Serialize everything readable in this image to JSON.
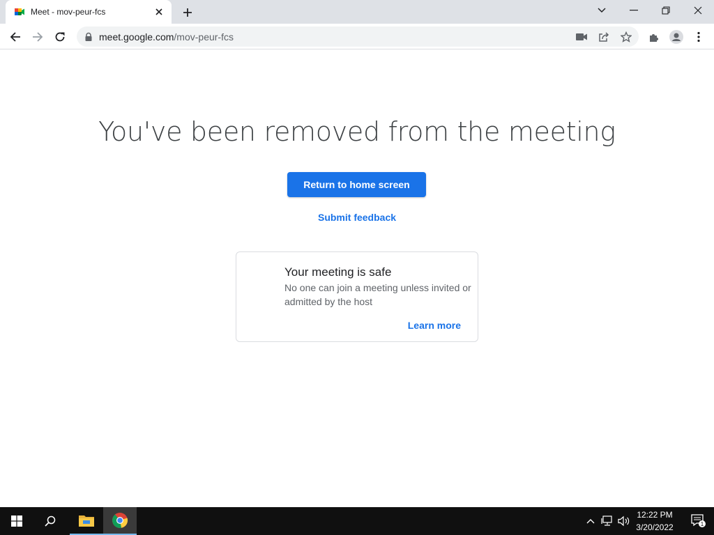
{
  "browser": {
    "tab": {
      "title": "Meet - mov-peur-fcs"
    },
    "omnibox": {
      "domain": "meet.google.com",
      "path": "/mov-peur-fcs"
    }
  },
  "page": {
    "headline": "You've been removed from the meeting",
    "return_button": "Return to home screen",
    "feedback_link": "Submit feedback",
    "card": {
      "title": "Your meeting is safe",
      "body": "No one can join a meeting unless invited or admitted by the host",
      "link": "Learn more"
    }
  },
  "taskbar": {
    "time": "12:22 PM",
    "date": "3/20/2022",
    "notification_count": "1"
  },
  "colors": {
    "accent": "#1a73e8",
    "titlebar": "#dee1e6",
    "taskbar": "#101010"
  }
}
